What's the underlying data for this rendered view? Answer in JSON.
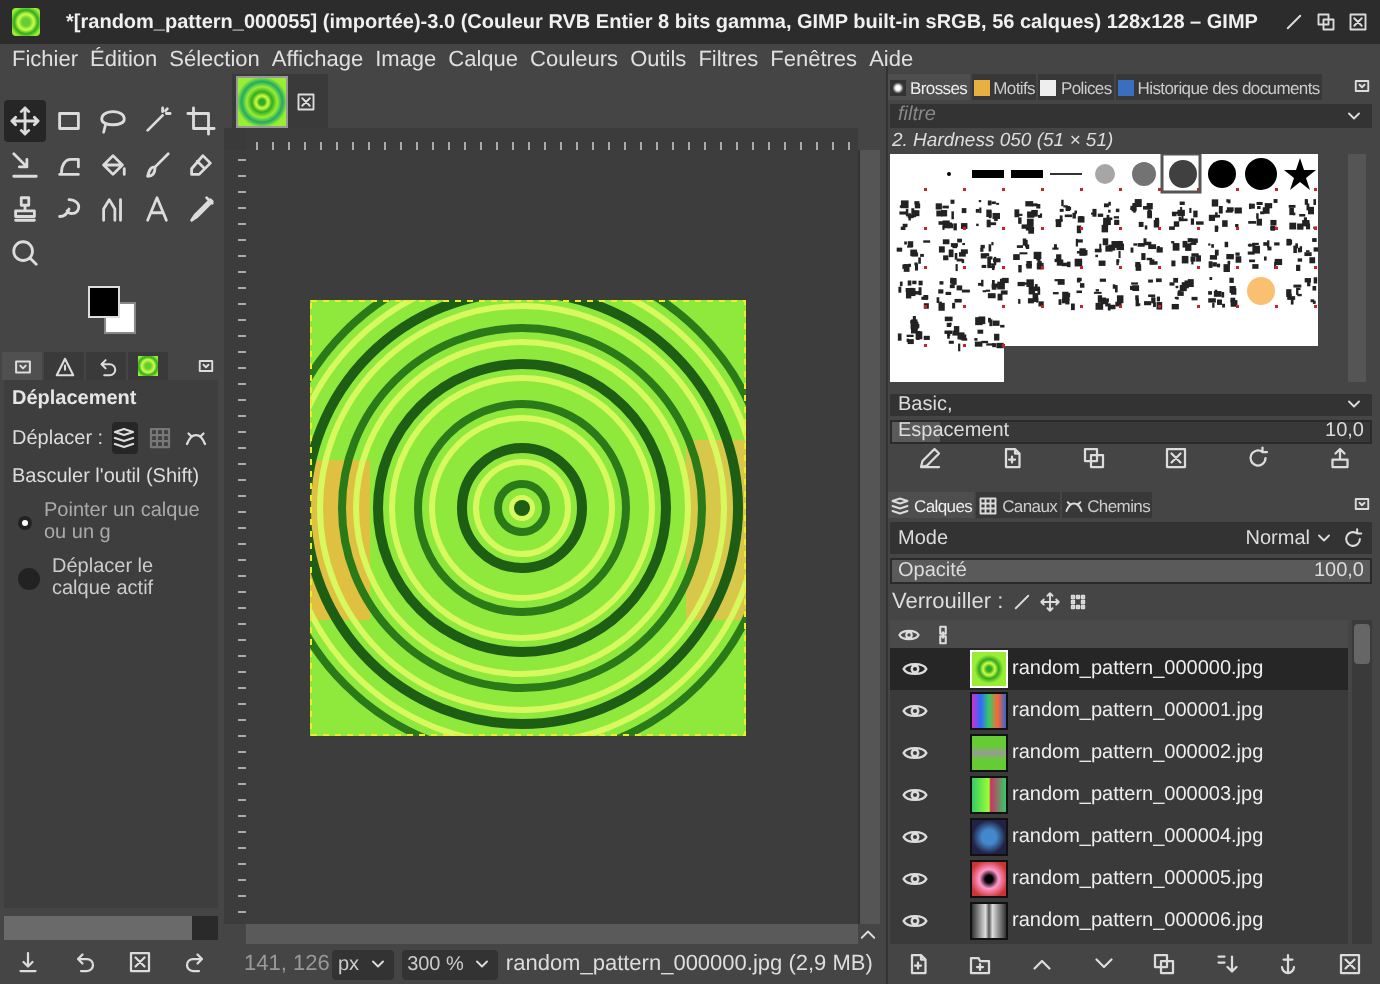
{
  "window": {
    "title": "*[random_pattern_000055] (importée)-3.0 (Couleur RVB Entier 8 bits gamma, GIMP built-in sRGB, 56 calques) 128x128 – GIMP"
  },
  "menu": [
    "Fichier",
    "Édition",
    "Sélection",
    "Affichage",
    "Image",
    "Calque",
    "Couleurs",
    "Outils",
    "Filtres",
    "Fenêtres",
    "Aide"
  ],
  "toolbox": {
    "tools": [
      {
        "selected": true
      },
      {
        "selected": false
      },
      {
        "selected": false
      },
      {
        "selected": false
      },
      {
        "selected": false
      },
      {
        "selected": false
      },
      {
        "selected": false
      },
      {
        "selected": false
      },
      {
        "selected": false
      },
      {
        "selected": false
      },
      {
        "selected": false
      },
      {
        "selected": false
      },
      {
        "selected": false
      },
      {
        "selected": false
      },
      {
        "selected": false
      },
      {
        "selected": false
      }
    ]
  },
  "tool_options": {
    "tabs": [
      {
        "selected": true
      },
      {
        "selected": false
      },
      {
        "selected": false
      },
      {
        "selected": false
      }
    ],
    "title": "Déplacement",
    "move_label": "Déplacer :",
    "move_modes": [
      {
        "selected": true
      },
      {
        "selected": false
      },
      {
        "selected": false
      }
    ],
    "toggle_label": "Basculer l'outil (Shift)",
    "toggle_options": [
      {
        "label": "Pointer un calque ou un g",
        "selected": true
      },
      {
        "label": "Déplacer le calque actif",
        "selected": false
      }
    ]
  },
  "status_bar": {
    "coordinates": "141, 126",
    "unit": "px",
    "zoom": "300 %",
    "info": "random_pattern_000000.jpg (2,9 MB)"
  },
  "brushes_dock": {
    "tabs": [
      {
        "label": "Brosses",
        "selected": true
      },
      {
        "label": "Motifs",
        "selected": false
      },
      {
        "label": "Polices",
        "selected": false
      },
      {
        "label": "Historique des documents",
        "selected": false
      }
    ],
    "filter": {
      "placeholder": "filtre"
    },
    "brush_name": "2. Hardness 050 (51 × 51)",
    "tag": "Basic,",
    "spacing": {
      "label": "Espacement",
      "value": "10,0",
      "level": 0.1
    }
  },
  "layers_dock": {
    "tabs": [
      {
        "label": "Calques",
        "selected": true
      },
      {
        "label": "Canaux",
        "selected": false
      },
      {
        "label": "Chemins",
        "selected": false
      }
    ],
    "mode": {
      "label": "Mode",
      "value": "Normal"
    },
    "opacity": {
      "label": "Opacité",
      "value": "100,0",
      "level": 1
    },
    "lock_label": "Verrouiller :",
    "layers": [
      {
        "name": "random_pattern_000000.jpg",
        "visible": true,
        "selected": true
      },
      {
        "name": "random_pattern_000001.jpg",
        "visible": true,
        "selected": false
      },
      {
        "name": "random_pattern_000002.jpg",
        "visible": true,
        "selected": false
      },
      {
        "name": "random_pattern_000003.jpg",
        "visible": true,
        "selected": false
      },
      {
        "name": "random_pattern_000004.jpg",
        "visible": true,
        "selected": false
      },
      {
        "name": "random_pattern_000005.jpg",
        "visible": true,
        "selected": false
      },
      {
        "name": "random_pattern_000006.jpg",
        "visible": true,
        "selected": false
      }
    ]
  }
}
